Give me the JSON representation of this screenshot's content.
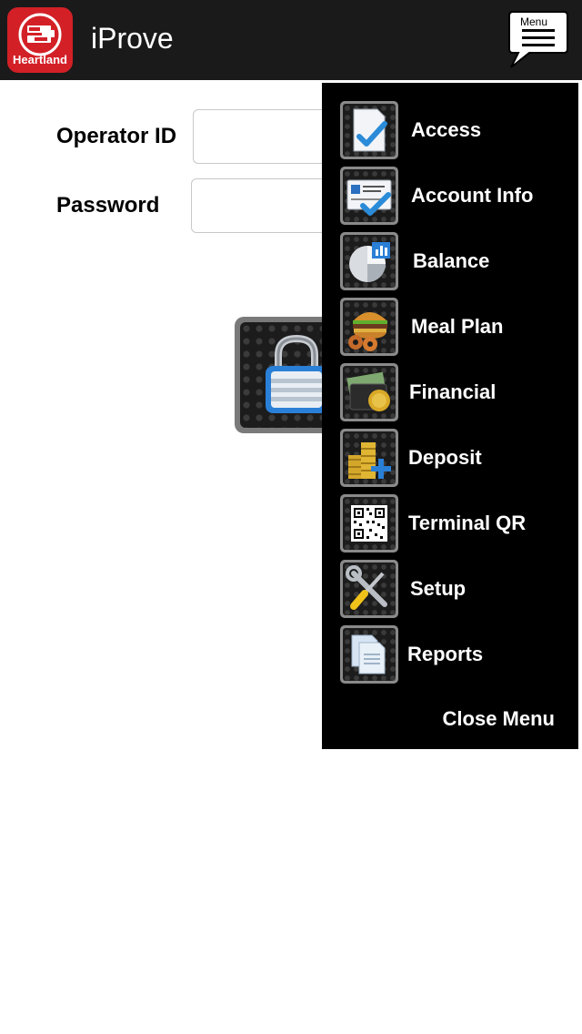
{
  "header": {
    "logo_text": "Heartland",
    "title": "iProve",
    "menu_label": "Menu"
  },
  "login": {
    "operator_label": "Operator ID",
    "password_label": "Password",
    "operator_value": "",
    "password_value": ""
  },
  "menu": {
    "items": [
      {
        "label": "Access",
        "icon": "document-check-icon"
      },
      {
        "label": "Account Info",
        "icon": "id-card-check-icon"
      },
      {
        "label": "Balance",
        "icon": "pie-chart-icon"
      },
      {
        "label": "Meal Plan",
        "icon": "burger-donuts-icon"
      },
      {
        "label": "Financial",
        "icon": "wallet-money-icon"
      },
      {
        "label": "Deposit",
        "icon": "coins-plus-icon"
      },
      {
        "label": "Terminal QR",
        "icon": "qr-code-icon"
      },
      {
        "label": "Setup",
        "icon": "tools-icon"
      },
      {
        "label": "Reports",
        "icon": "documents-icon"
      }
    ],
    "close_label": "Close Menu"
  },
  "colors": {
    "header_bg": "#1a1a1a",
    "brand_red": "#d32027",
    "menu_bg": "#000000"
  }
}
